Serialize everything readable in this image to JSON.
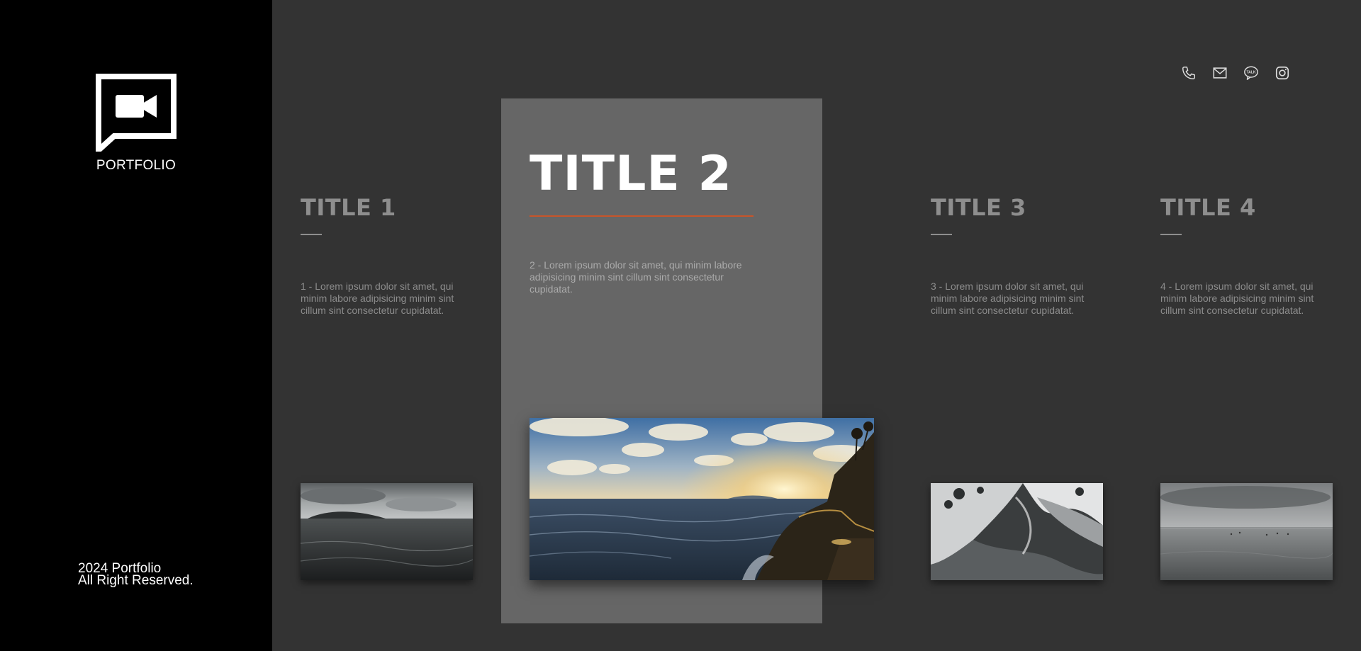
{
  "sidebar": {
    "logo_icon": "video-chat-icon",
    "logo_text": "PORTFOLIO",
    "footer_line1": "2024 Portfolio",
    "footer_line2": "All Right Reserved."
  },
  "socials": [
    {
      "icon": "phone-icon"
    },
    {
      "icon": "mail-icon"
    },
    {
      "icon": "talk-icon",
      "text": "TALK"
    },
    {
      "icon": "instagram-icon"
    }
  ],
  "items": [
    {
      "title": "TITLE 1",
      "description": "1 - Lorem ipsum dolor sit amet, qui minim labore adipisicing minim sint cillum sint consectetur cupidatat."
    },
    {
      "title": "TITLE 2",
      "description": "2 - Lorem ipsum dolor sit amet, qui minim labore adipisicing minim sint cillum sint consectetur cupidatat."
    },
    {
      "title": "TITLE 3",
      "description": "3 - Lorem ipsum dolor sit amet, qui minim labore adipisicing minim sint cillum sint consectetur cupidatat."
    },
    {
      "title": "TITLE 4",
      "description": "4 - Lorem ipsum dolor sit amet, qui minim labore adipisicing minim sint cillum sint consectetur cupidatat."
    }
  ],
  "colors": {
    "accent": "#c8552a",
    "sidebar_bg": "#000000",
    "main_bg": "#333333",
    "active_panel": "#666666"
  }
}
